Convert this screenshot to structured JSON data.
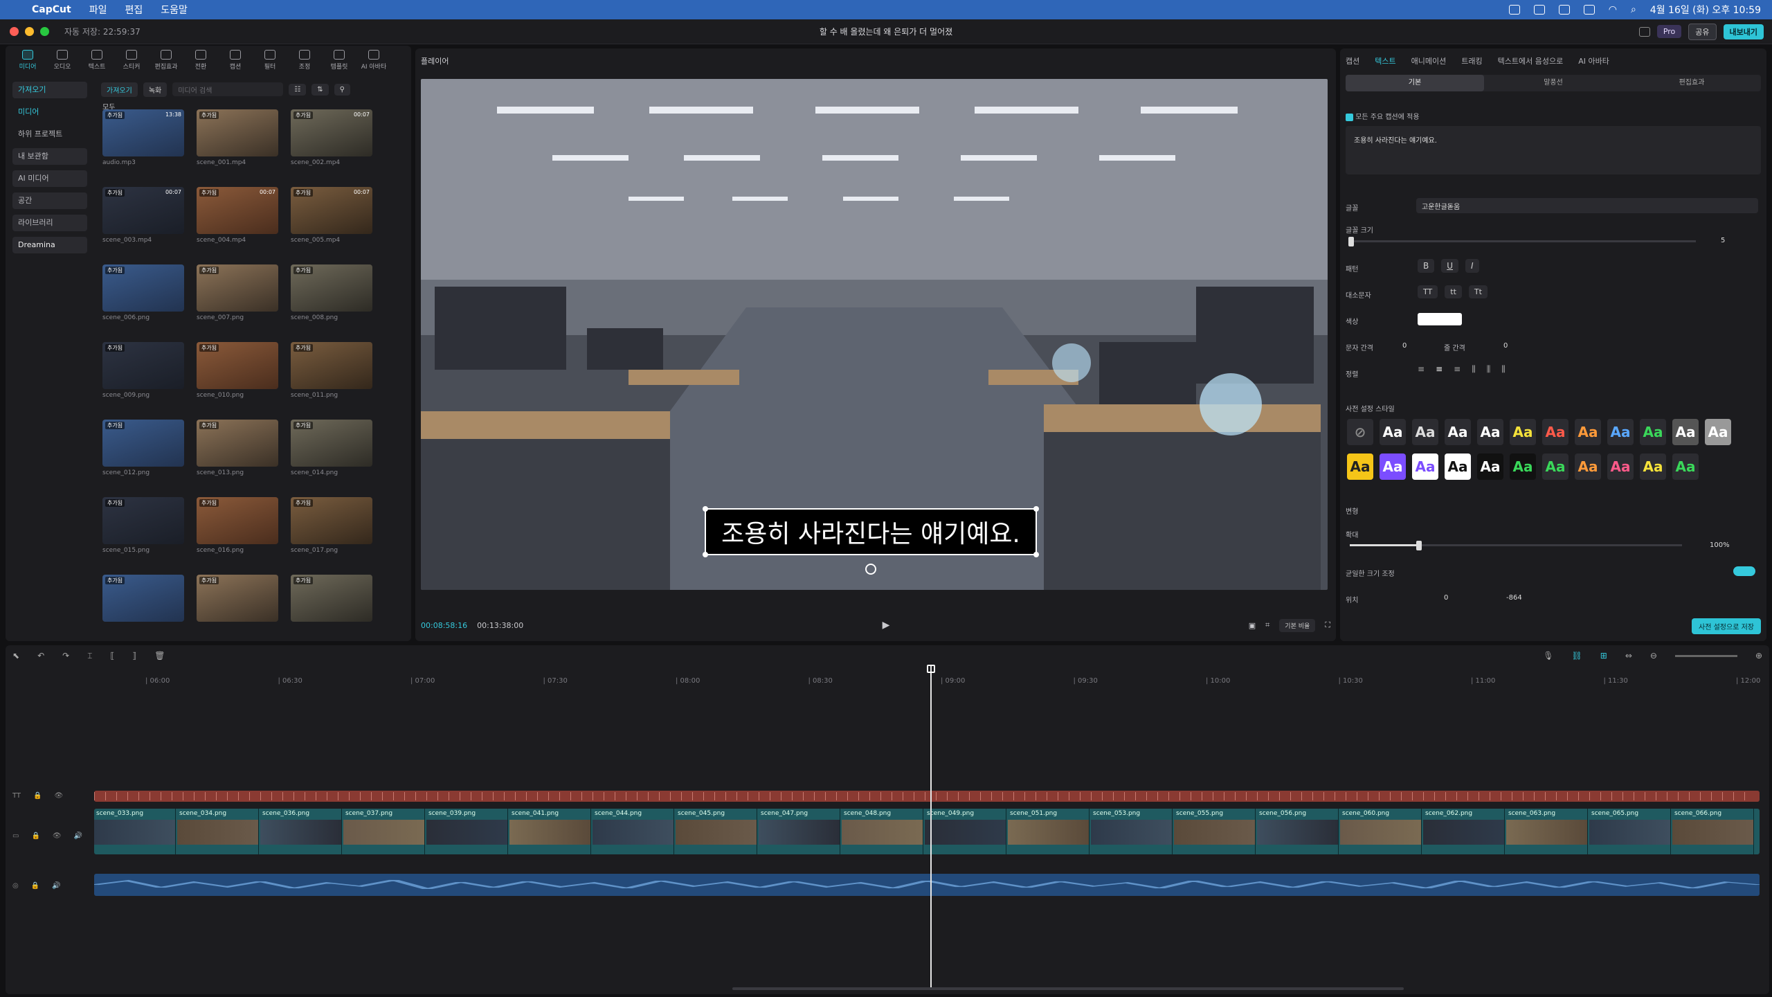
{
  "menubar": {
    "app": "CapCut",
    "items": [
      "파일",
      "편집",
      "도움말"
    ],
    "clock": "4월 16일 (화) 오후 10:59"
  },
  "window": {
    "autosave": "자동 저장: 22:59:37",
    "title": "할 수 배 올렸는데 왜 은퇴가 더 멀어졌",
    "pro": "Pro",
    "share": "공유",
    "export": "내보내기"
  },
  "toolbar": [
    "미디어",
    "오디오",
    "텍스트",
    "스티커",
    "편집효과",
    "전환",
    "캡션",
    "필터",
    "조정",
    "템플릿",
    "AI 아바타"
  ],
  "sidebar": [
    "가져오기",
    "미디어",
    "하위 프로젝트",
    "내 보관함",
    "AI 미디어",
    "공간",
    "라이브러리",
    "Dreamina"
  ],
  "media": {
    "import_btn": "가져오기",
    "record_btn": "녹화",
    "search_placeholder": "미디어 검색",
    "section": "모두",
    "badge": "추가됨",
    "items": [
      {
        "name": "audio.mp3",
        "dur": "13:38"
      },
      {
        "name": "scene_001.mp4",
        "dur": ""
      },
      {
        "name": "scene_002.mp4",
        "dur": "00:07"
      },
      {
        "name": "scene_003.mp4",
        "dur": "00:07"
      },
      {
        "name": "scene_004.mp4",
        "dur": "00:07"
      },
      {
        "name": "scene_005.mp4",
        "dur": "00:07"
      },
      {
        "name": "scene_006.png",
        "dur": ""
      },
      {
        "name": "scene_007.png",
        "dur": ""
      },
      {
        "name": "scene_008.png",
        "dur": ""
      },
      {
        "name": "scene_009.png",
        "dur": ""
      },
      {
        "name": "scene_010.png",
        "dur": ""
      },
      {
        "name": "scene_011.png",
        "dur": ""
      },
      {
        "name": "scene_012.png",
        "dur": ""
      },
      {
        "name": "scene_013.png",
        "dur": ""
      },
      {
        "name": "scene_014.png",
        "dur": ""
      },
      {
        "name": "scene_015.png",
        "dur": ""
      },
      {
        "name": "scene_016.png",
        "dur": ""
      },
      {
        "name": "scene_017.png",
        "dur": ""
      },
      {
        "name": "",
        "dur": ""
      },
      {
        "name": "",
        "dur": ""
      },
      {
        "name": "",
        "dur": ""
      }
    ]
  },
  "player": {
    "title": "플레이어",
    "subtitle": "조용히 사라진다는 얘기예요.",
    "current": "00:08:58:16",
    "total": "00:13:38:00",
    "ratio": "기본 비율"
  },
  "props": {
    "tabs": [
      "캡션",
      "텍스트",
      "애니메이션",
      "트래킹",
      "텍스트에서 음성으로",
      "AI 아바타"
    ],
    "subtabs": [
      "기본",
      "말풍선",
      "편집효과"
    ],
    "apply_all": "모든 주요 캡션에 적용",
    "text_value": "조용히 사라진다는 얘기예요.",
    "font_label": "글꼴",
    "font_value": "고운한글돋움",
    "size_label": "글꼴 크기",
    "size_value": "5",
    "pattern_label": "패턴",
    "case_label": "대소문자",
    "color_label": "색상",
    "spacing_label": "문자 간격",
    "spacing_value": "0",
    "line_label": "줄 간격",
    "line_value": "0",
    "align_label": "정렬",
    "preset_label": "사전 설정 스타일",
    "transform_label": "변형",
    "scale_label": "확대",
    "scale_value": "100%",
    "uniform_label": "균일한 크기 조정",
    "pos_label": "위치",
    "x_value": "0",
    "y_value": "-864",
    "save_preset": "사전 설정으로 저장"
  },
  "timeline": {
    "ticks": [
      "06:00",
      "06:30",
      "07:00",
      "07:30",
      "08:00",
      "08:30",
      "09:00",
      "09:30",
      "10:00",
      "10:30",
      "11:00",
      "11:30",
      "12:00"
    ],
    "clips": [
      "scene_033.png",
      "scene_034.png",
      "scene_036.png",
      "scene_037.png",
      "scene_039.png",
      "scene_041.png",
      "scene_044.png",
      "scene_045.png",
      "scene_047.png",
      "scene_048.png",
      "scene_049.png",
      "scene_051.png",
      "scene_053.png",
      "scene_055.png",
      "scene_056.png",
      "scene_060.png",
      "scene_062.png",
      "scene_063.png",
      "scene_065.png",
      "scene_066.png"
    ]
  },
  "colors": {
    "accent": "#35c9dc",
    "subtitle_track": "#8a3a32",
    "audio_track": "#234a7a"
  }
}
